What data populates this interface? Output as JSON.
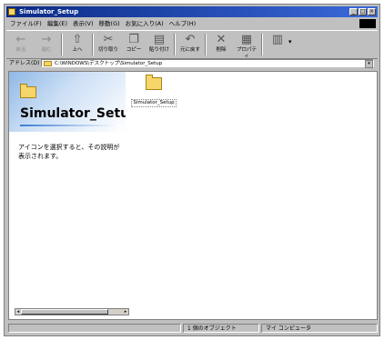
{
  "window": {
    "title": "Simulator_Setup"
  },
  "menu": {
    "items": [
      "ファイル(F)",
      "編集(E)",
      "表示(V)",
      "移動(G)",
      "お気に入り(A)",
      "ヘルプ(H)"
    ]
  },
  "toolbar": {
    "buttons": [
      {
        "icon": "back-arrow-icon",
        "label": "戻る"
      },
      {
        "icon": "forward-arrow-icon",
        "label": "進む"
      },
      {
        "icon": "up-folder-icon",
        "label": "上へ"
      },
      {
        "icon": "cut-icon",
        "label": "切り取り"
      },
      {
        "icon": "copy-icon",
        "label": "コピー"
      },
      {
        "icon": "paste-icon",
        "label": "貼り付け"
      },
      {
        "icon": "undo-icon",
        "label": "元に戻す"
      },
      {
        "icon": "delete-icon",
        "label": "削除"
      },
      {
        "icon": "properties-icon",
        "label": "プロパティ"
      },
      {
        "icon": "views-icon",
        "label": ""
      }
    ]
  },
  "address": {
    "label": "アドレス(D)",
    "value": "C:\\WINDOWS\\デスクトップ\\Simulator_Setup"
  },
  "sidepanel": {
    "title": "Simulator_Setup",
    "description": "アイコンを選択すると、その説明が表示されます。"
  },
  "items": [
    {
      "label": "Simulator_Setup",
      "icon": "folder-icon"
    }
  ],
  "status": {
    "count": "1 個のオブジェクト",
    "location": "マイ コンピュータ"
  },
  "colors": {
    "titlebar": "#0a2a86",
    "face": "#c0c0c0",
    "folder": "#f6d66a"
  }
}
